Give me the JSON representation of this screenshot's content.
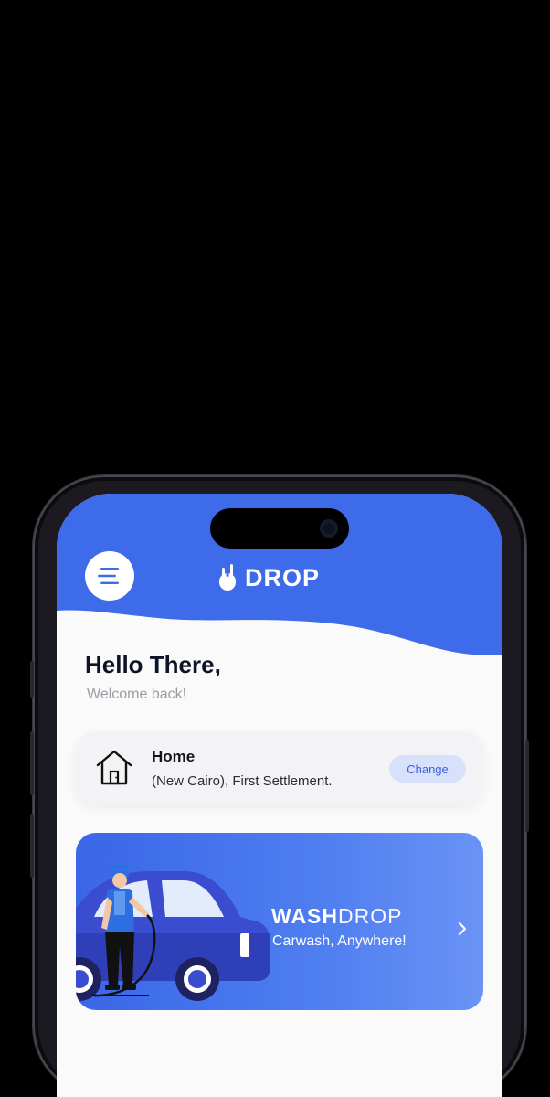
{
  "app": {
    "logo_text": "DROP",
    "accent": "#3d6bea"
  },
  "header": {
    "menu_icon": "menu-icon"
  },
  "greeting": {
    "title": "Hello There,",
    "subtitle": "Welcome back!"
  },
  "address": {
    "icon": "home-icon",
    "label": "Home",
    "detail": "(New Cairo), First Settlement.",
    "change_label": "Change"
  },
  "service_card": {
    "title_bold": "WASH",
    "title_light": "DROP",
    "subtitle": "Carwash, Anywhere!",
    "chevron_icon": "chevron-right-icon"
  }
}
